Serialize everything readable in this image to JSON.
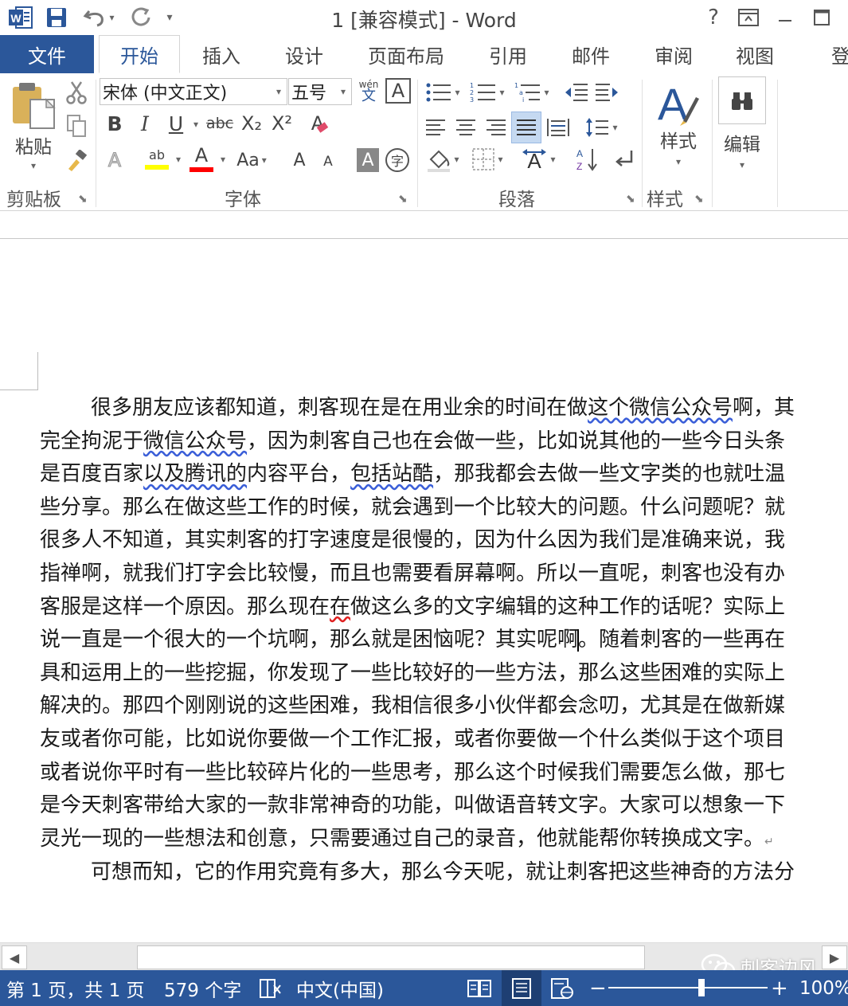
{
  "titlebar": {
    "title": "1 [兼容模式] - Word",
    "help": "?",
    "ribbon_display": "⇱",
    "minimize": "—",
    "maximize": "☐"
  },
  "quick_access": {
    "app_icon": "word-icon",
    "save": "save-icon",
    "undo": "undo-icon",
    "redo": "redo-icon",
    "customize": "customize-icon"
  },
  "tabs": [
    {
      "label": "文件"
    },
    {
      "label": "开始"
    },
    {
      "label": "插入"
    },
    {
      "label": "设计"
    },
    {
      "label": "页面布局"
    },
    {
      "label": "引用"
    },
    {
      "label": "邮件"
    },
    {
      "label": "审阅"
    },
    {
      "label": "视图"
    },
    {
      "label": "登"
    }
  ],
  "ribbon": {
    "clipboard": {
      "label": "剪贴板",
      "paste": "粘贴"
    },
    "font": {
      "label": "字体",
      "font_name": "宋体 (中文正文)",
      "font_size": "五号",
      "bold": "B",
      "italic": "I",
      "underline": "U",
      "strike": "abc",
      "subscript": "X₂",
      "superscript": "X²",
      "clear_format": "A",
      "text_effects": "A",
      "highlight": "ab",
      "font_color": "A",
      "change_case": "Aa",
      "grow": "A",
      "shrink": "A",
      "shading": "A",
      "enclose": "字",
      "phonetic_top": "wén",
      "phonetic_bottom": "文",
      "char_border": "A"
    },
    "paragraph": {
      "label": "段落"
    },
    "styles": {
      "label": "样式",
      "button": "样式"
    },
    "editing": {
      "button": "编辑"
    }
  },
  "document": {
    "paragraph1_lines": [
      [
        "很多朋友应该都知道，刺客现在是在用业余的时间在做",
        {
          "wavy": "blue",
          "t": "这个微信公众号"
        },
        "啊，其"
      ],
      [
        "完全拘泥于",
        {
          "wavy": "blue",
          "t": "微信公众号"
        },
        "，因为刺客自己也在会做一些，比如说其他的一些今日头条"
      ],
      [
        "是百度百家",
        {
          "wavy": "blue",
          "t": "以及腾讯的"
        },
        "内容平台，",
        {
          "wavy": "blue",
          "t": "包括站酷"
        },
        "，那我都会去做一些文字类的也就吐温"
      ],
      [
        "些分享。那么在做这些工作的时候，就会遇到一个比较大的问题。什么问题呢？就"
      ],
      [
        "很多人不知道，其实刺客的打字速度是很慢的，因为什么因为我们是准确来说，我"
      ],
      [
        "指禅啊，就我们打字会比较慢，而且也需要看屏幕啊。所以一直呢，刺客也没有办"
      ],
      [
        "客服是这样一个原因。那么现在",
        {
          "wavy": "red",
          "t": "在"
        },
        "做这么多的文字编辑的这种工作的话呢？实际上"
      ],
      [
        "说一直是一个很大的一个坑啊，那么就是困恼呢？其实呢啊",
        {
          "caret": true
        },
        "。随着刺客的一些再在"
      ],
      [
        "具和运用上的一些挖掘，你发现了一些比较好的一些方法，那么这些困难的实际上"
      ],
      [
        "解决的。那四个刚刚说的这些困难，我相信很多小伙伴都会念叨，尤其是在做新媒"
      ],
      [
        "友或者你可能，比如说你要做一个工作汇报，或者你要做一个什么类似于这个项目"
      ],
      [
        "或者说你平时有一些比较碎片化的一些思考，那么这个时候我们需要怎么做，那七"
      ],
      [
        "是今天刺客带给大家的一款非常神奇的功能，叫做语音转文字。大家可以想象一下"
      ],
      [
        "灵光一现的一些想法和创意，只需要通过自己的录音，他就能帮你转换成文字。",
        {
          "pilcrow": true
        }
      ]
    ],
    "paragraph2": "可想而知，它的作用究竟有多大，那么今天呢，就让刺客把这些神奇的方法分"
  },
  "watermark": "刺客边风",
  "statusbar": {
    "page": "第 1 页，共 1 页",
    "words": "579 个字",
    "language": "中文(中国)",
    "zoom_minus": "−",
    "zoom_plus": "+",
    "zoom": "100%",
    "zoom_level_percent": 100
  },
  "colors": {
    "accent": "#2b579a",
    "spell_wavy": "#e02020",
    "grammar_wavy": "#3a5ed8",
    "highlight": "#ffff00",
    "font_color": "#ff0000"
  }
}
